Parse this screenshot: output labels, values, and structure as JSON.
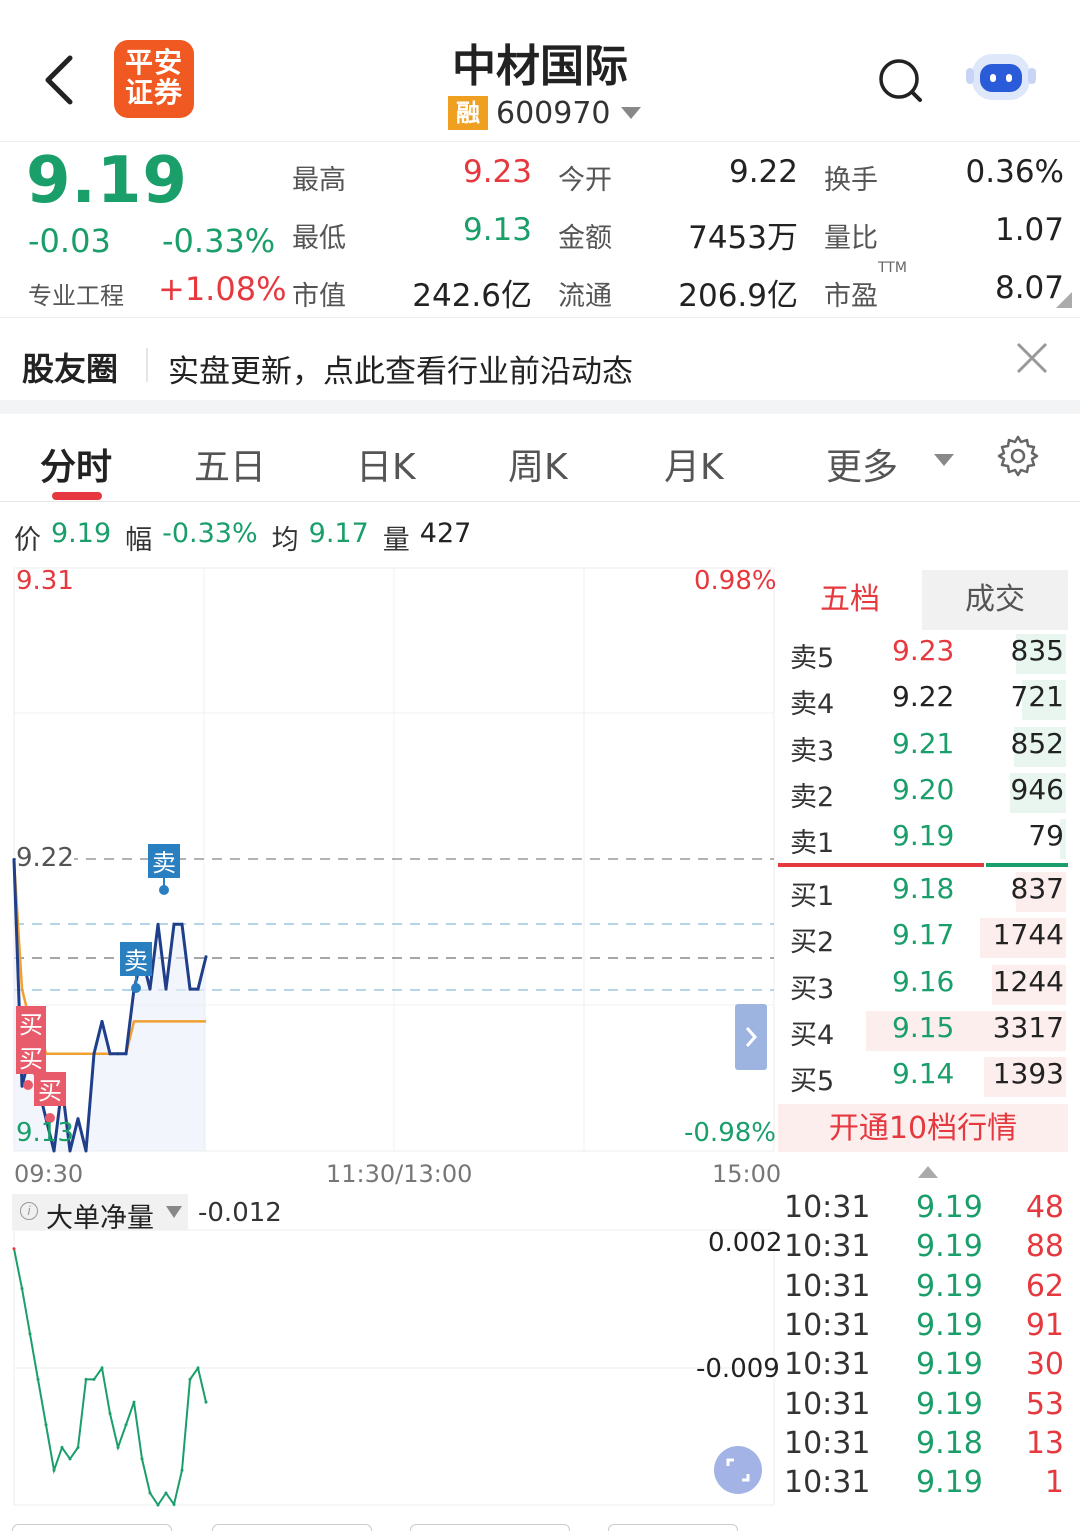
{
  "header": {
    "logo_line1": "平安",
    "logo_line2": "证券",
    "stock_name": "中材国际",
    "margin_badge": "融",
    "stock_code": "600970"
  },
  "quote": {
    "price": "9.19",
    "change": "-0.03",
    "change_pct": "-0.33%",
    "sector_name": "专业工程",
    "sector_pct": "+1.08%",
    "fields": [
      {
        "label": "最高",
        "value": "9.23",
        "color": "red"
      },
      {
        "label": "今开",
        "value": "9.22",
        "color": "dark"
      },
      {
        "label": "换手",
        "value": "0.36%",
        "color": "dark"
      },
      {
        "label": "最低",
        "value": "9.13",
        "color": "green"
      },
      {
        "label": "金额",
        "value": "7453万",
        "color": "dark"
      },
      {
        "label": "量比",
        "value": "1.07",
        "color": "dark"
      },
      {
        "label": "市值",
        "value": "242.6亿",
        "color": "dark"
      },
      {
        "label": "流通",
        "value": "206.9亿",
        "color": "dark"
      },
      {
        "label": "市盈",
        "value": "8.07",
        "color": "dark"
      }
    ],
    "ttm": "TTM"
  },
  "banner": {
    "label": "股友圈",
    "text": "实盘更新，点此查看行业前沿动态"
  },
  "tabs": [
    {
      "label": "分时",
      "active": true
    },
    {
      "label": "五日"
    },
    {
      "label": "日K"
    },
    {
      "label": "周K"
    },
    {
      "label": "月K"
    },
    {
      "label": "更多"
    }
  ],
  "info_line": {
    "price_label": "价",
    "price": "9.19",
    "range_label": "幅",
    "range": "-0.33%",
    "avg_label": "均",
    "avg": "9.17",
    "vol_label": "量",
    "vol": "427"
  },
  "chart": {
    "y_top_left": "9.31",
    "y_top_right": "0.98%",
    "y_mid_left": "9.22",
    "y_bottom_left": "9.13",
    "y_bottom_right": "-0.98%",
    "times": [
      "09:30",
      "11:30/13:00",
      "15:00"
    ],
    "markers": [
      {
        "label": "卖",
        "type": "sell"
      },
      {
        "label": "卖",
        "type": "sell"
      },
      {
        "label": "买",
        "type": "buy"
      },
      {
        "label": "买",
        "type": "buy"
      },
      {
        "label": "买",
        "type": "buy"
      }
    ],
    "colors": {
      "price_line": "#1f3f8a",
      "avg_line": "#f0a030",
      "up": "#e6393f",
      "down": "#1a9e6a"
    }
  },
  "chart_data": {
    "type": "line",
    "ylim": [
      9.13,
      9.31
    ],
    "prev_close": 9.22,
    "series": [
      {
        "values": [
          9.22,
          9.15,
          9.16,
          9.15,
          9.14,
          9.13,
          9.15,
          9.13,
          9.14,
          9.13,
          9.16,
          9.17,
          9.16,
          9.16,
          9.16,
          9.18,
          9.19,
          9.18,
          9.2,
          9.18,
          9.2,
          9.2,
          9.18,
          9.18,
          9.19
        ]
      },
      {
        "values": [
          9.22,
          9.18,
          9.17,
          9.17,
          9.16,
          9.16,
          9.16,
          9.16,
          9.16,
          9.16,
          9.16,
          9.16,
          9.16,
          9.16,
          9.16,
          9.17,
          9.17,
          9.17,
          9.17,
          9.17,
          9.17,
          9.17,
          9.17,
          9.17,
          9.17
        ]
      }
    ]
  },
  "order_book": {
    "tab_5": "五档",
    "tab_trades": "成交",
    "asks": [
      {
        "label": "卖5",
        "price": "9.23",
        "vol": "835",
        "color": "red",
        "bar": 0.25
      },
      {
        "label": "卖4",
        "price": "9.22",
        "vol": "721",
        "color": "dark",
        "bar": 0.22
      },
      {
        "label": "卖3",
        "price": "9.21",
        "vol": "852",
        "color": "green",
        "bar": 0.26
      },
      {
        "label": "卖2",
        "price": "9.20",
        "vol": "946",
        "color": "green",
        "bar": 0.28
      },
      {
        "label": "卖1",
        "price": "9.19",
        "vol": "79",
        "color": "green",
        "bar": 0.03
      }
    ],
    "bids": [
      {
        "label": "买1",
        "price": "9.18",
        "vol": "837",
        "color": "green",
        "bar": 0.25
      },
      {
        "label": "买2",
        "price": "9.17",
        "vol": "1744",
        "color": "green",
        "bar": 0.43
      },
      {
        "label": "买3",
        "price": "9.16",
        "vol": "1244",
        "color": "green",
        "bar": 0.37
      },
      {
        "label": "买4",
        "price": "9.15",
        "vol": "3317",
        "color": "green",
        "bar": 1.0
      },
      {
        "label": "买5",
        "price": "9.14",
        "vol": "1393",
        "color": "green",
        "bar": 0.41
      }
    ],
    "open_10": "开通10档行情"
  },
  "trades": [
    {
      "time": "10:31",
      "price": "9.19",
      "vol": "48"
    },
    {
      "time": "10:31",
      "price": "9.19",
      "vol": "88"
    },
    {
      "time": "10:31",
      "price": "9.19",
      "vol": "62"
    },
    {
      "time": "10:31",
      "price": "9.19",
      "vol": "91"
    },
    {
      "time": "10:31",
      "price": "9.19",
      "vol": "30"
    },
    {
      "time": "10:31",
      "price": "9.19",
      "vol": "53"
    },
    {
      "time": "10:31",
      "price": "9.18",
      "vol": "13"
    },
    {
      "time": "10:31",
      "price": "9.19",
      "vol": "1"
    }
  ],
  "indicator": {
    "name": "大单净量",
    "value": "-0.012",
    "y_top": "0.002",
    "y_mid": "-0.009",
    "series": [
      0.0015,
      -0.002,
      -0.006,
      -0.01,
      -0.014,
      -0.018,
      -0.016,
      -0.017,
      -0.016,
      -0.01,
      -0.01,
      -0.009,
      -0.013,
      -0.016,
      -0.014,
      -0.012,
      -0.017,
      -0.02,
      -0.022,
      -0.02,
      -0.021,
      -0.018,
      -0.01,
      -0.009,
      -0.012
    ]
  }
}
